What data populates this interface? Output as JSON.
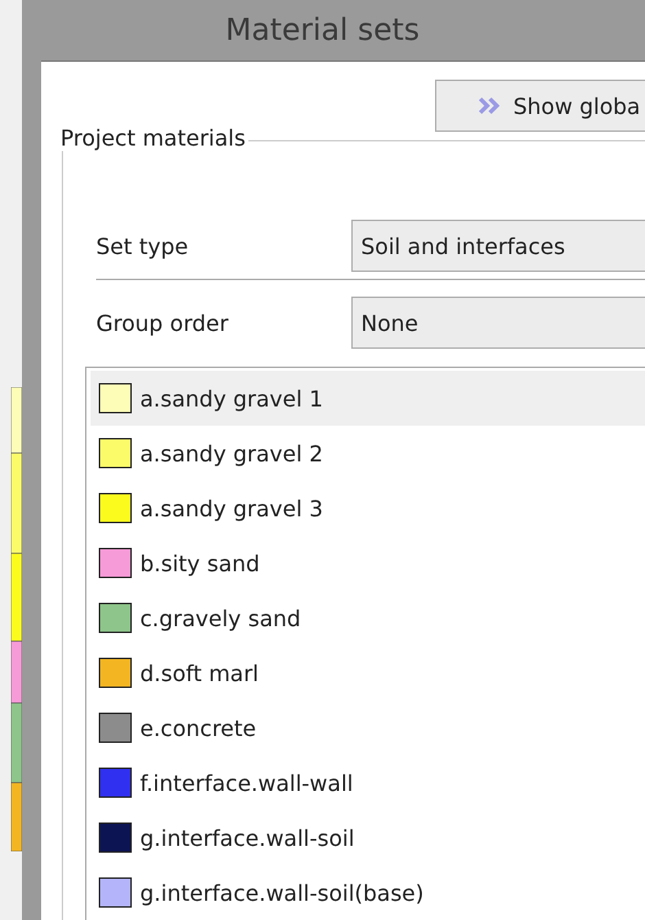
{
  "window": {
    "title": "Material sets"
  },
  "show_button": {
    "label": "Show globa"
  },
  "group": {
    "title": "Project materials",
    "fields": [
      {
        "label": "Set type",
        "value": "Soil and interfaces"
      },
      {
        "label": "Group order",
        "value": "None"
      }
    ],
    "materials": [
      {
        "name": "a.sandy gravel 1",
        "color": "#fdfdb8",
        "selected": true
      },
      {
        "name": "a.sandy gravel 2",
        "color": "#fbfb6a",
        "selected": false
      },
      {
        "name": "a.sandy gravel 3",
        "color": "#fbfb1e",
        "selected": false
      },
      {
        "name": "b.sity sand",
        "color": "#f79ad8",
        "selected": false
      },
      {
        "name": "c.gravely sand",
        "color": "#8ec58a",
        "selected": false
      },
      {
        "name": "d.soft marl",
        "color": "#f3b521",
        "selected": false
      },
      {
        "name": "e.concrete",
        "color": "#8c8c8c",
        "selected": false
      },
      {
        "name": "f.interface.wall-wall",
        "color": "#3030f0",
        "selected": false
      },
      {
        "name": "g.interface.wall-soil",
        "color": "#0c1454",
        "selected": false
      },
      {
        "name": "g.interface.wall-soil(base)",
        "color": "#b4b4fb",
        "selected": false
      }
    ]
  }
}
